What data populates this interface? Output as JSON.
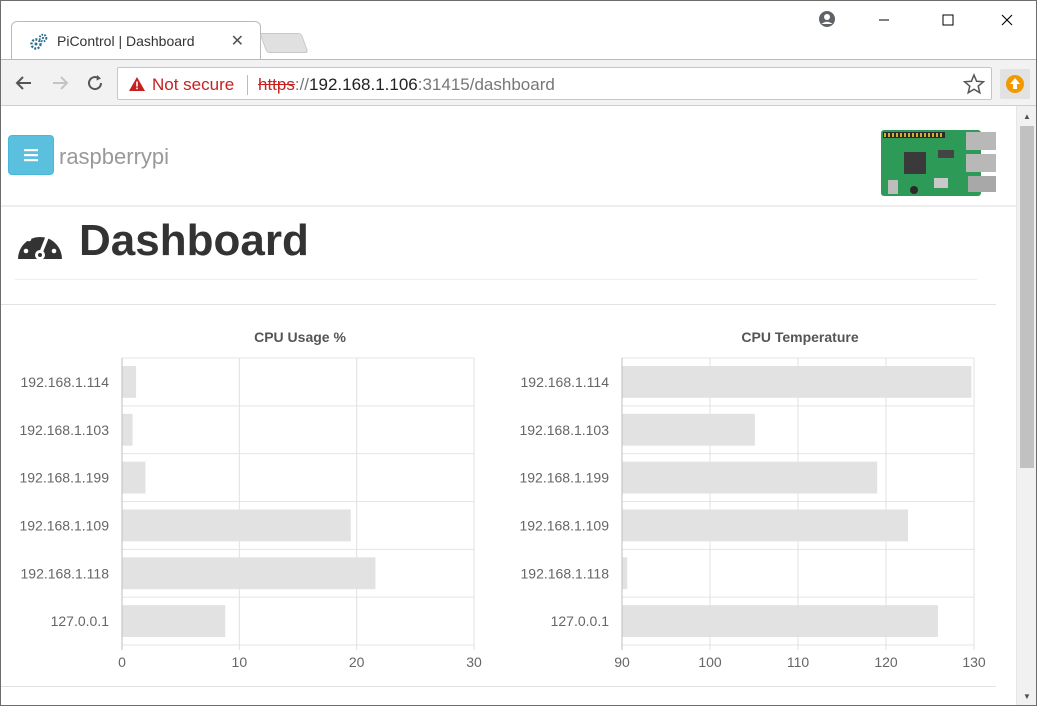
{
  "browser": {
    "tab_title": "PiControl | Dashboard",
    "not_secure_label": "Not secure",
    "url_scheme": "https",
    "url_sep": "://",
    "url_host": "192.168.1.106",
    "url_rest": ":31415/dashboard"
  },
  "navbar": {
    "brand": "raspberrypi"
  },
  "page": {
    "title": "Dashboard"
  },
  "chart_data": [
    {
      "type": "bar",
      "orientation": "horizontal",
      "title": "CPU Usage %",
      "categories": [
        "192.168.1.114",
        "192.168.1.103",
        "192.168.1.199",
        "192.168.1.109",
        "192.168.1.118",
        "127.0.0.1"
      ],
      "values": [
        1.2,
        0.9,
        2.0,
        19.5,
        21.6,
        8.8
      ],
      "xlim": [
        0,
        30
      ],
      "xticks": [
        0,
        10,
        20,
        30
      ],
      "bar_color": "#e2e2e2",
      "grid": true
    },
    {
      "type": "bar",
      "orientation": "horizontal",
      "title": "CPU Temperature",
      "categories": [
        "192.168.1.114",
        "192.168.1.103",
        "192.168.1.199",
        "192.168.1.109",
        "192.168.1.118",
        "127.0.0.1"
      ],
      "values": [
        129.7,
        105.1,
        119.0,
        122.5,
        90.6,
        125.9
      ],
      "xlim": [
        90,
        130
      ],
      "xticks": [
        90,
        100,
        110,
        120,
        130
      ],
      "bar_color": "#e2e2e2",
      "grid": true
    }
  ],
  "colors": {
    "accent": "#5bc0de",
    "warning": "#c5221f",
    "bar": "#e2e2e2"
  }
}
